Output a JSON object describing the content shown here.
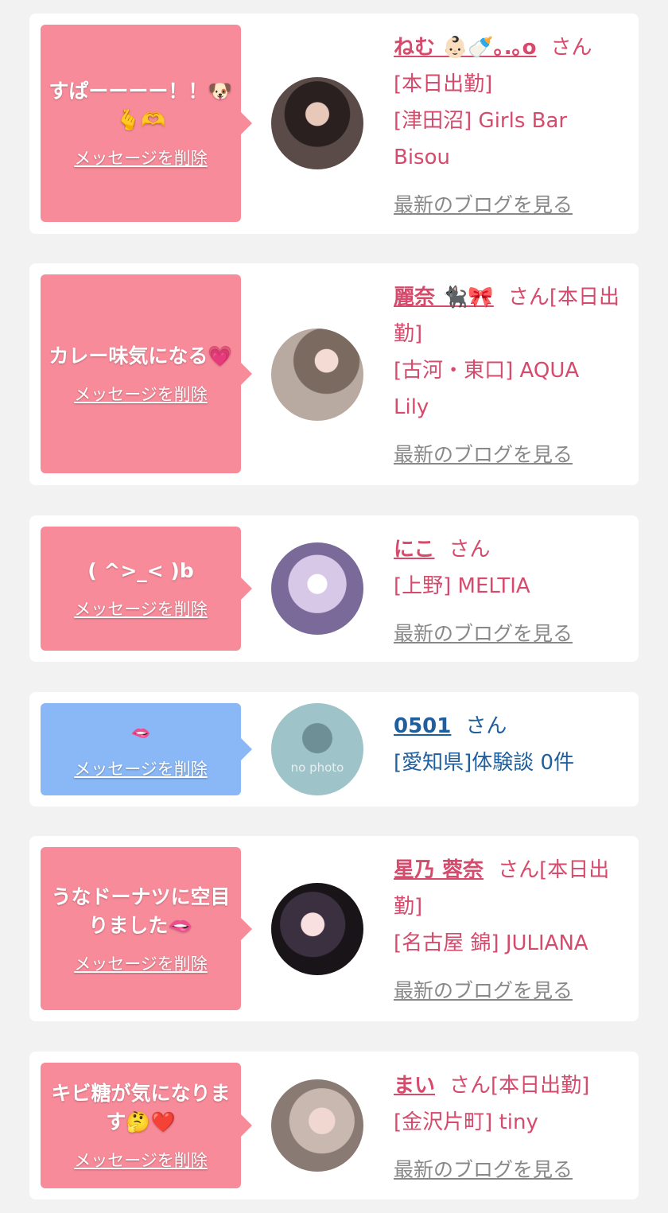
{
  "san_label": "さん",
  "delete_label": "メッセージを削除",
  "blog_label": "最新のブログを見る",
  "colors": {
    "pink_bubble": "#f78b9a",
    "blue_bubble": "#8ab8f6",
    "accent_pink": "#d64a6c",
    "accent_blue": "#1f5f9e"
  },
  "cards": [
    {
      "message": "すぱーーーー！！🐶🫰🫶",
      "name": "ねむ 👶🏻🍼｡.｡o",
      "status": "[本日出勤]",
      "shop": "[津田沼] Girls Bar Bisou"
    },
    {
      "message": "カレー味気になる💗",
      "name": "麗奈 🐈‍⬛🎀",
      "status": "[本日出勤]",
      "shop": "[古河・東口] AQUA Lily"
    },
    {
      "message": "( ^>_< )b",
      "name": "にこ",
      "status": "",
      "shop": "[上野] MELTIA"
    },
    {
      "message": "🫦",
      "name": "0501",
      "status": "",
      "shop": "[愛知県]体験談 0件",
      "avatar_text": "no photo"
    },
    {
      "message": "うなドーナツに空目りました🫦",
      "name": "星乃 蓉奈",
      "status": "[本日出勤]",
      "shop": "[名古屋 錦] JULIANA"
    },
    {
      "message": "キビ糖が気になります🤔❤️",
      "name": "まい",
      "status": "[本日出勤]",
      "shop": "[金沢片町] tiny"
    }
  ]
}
